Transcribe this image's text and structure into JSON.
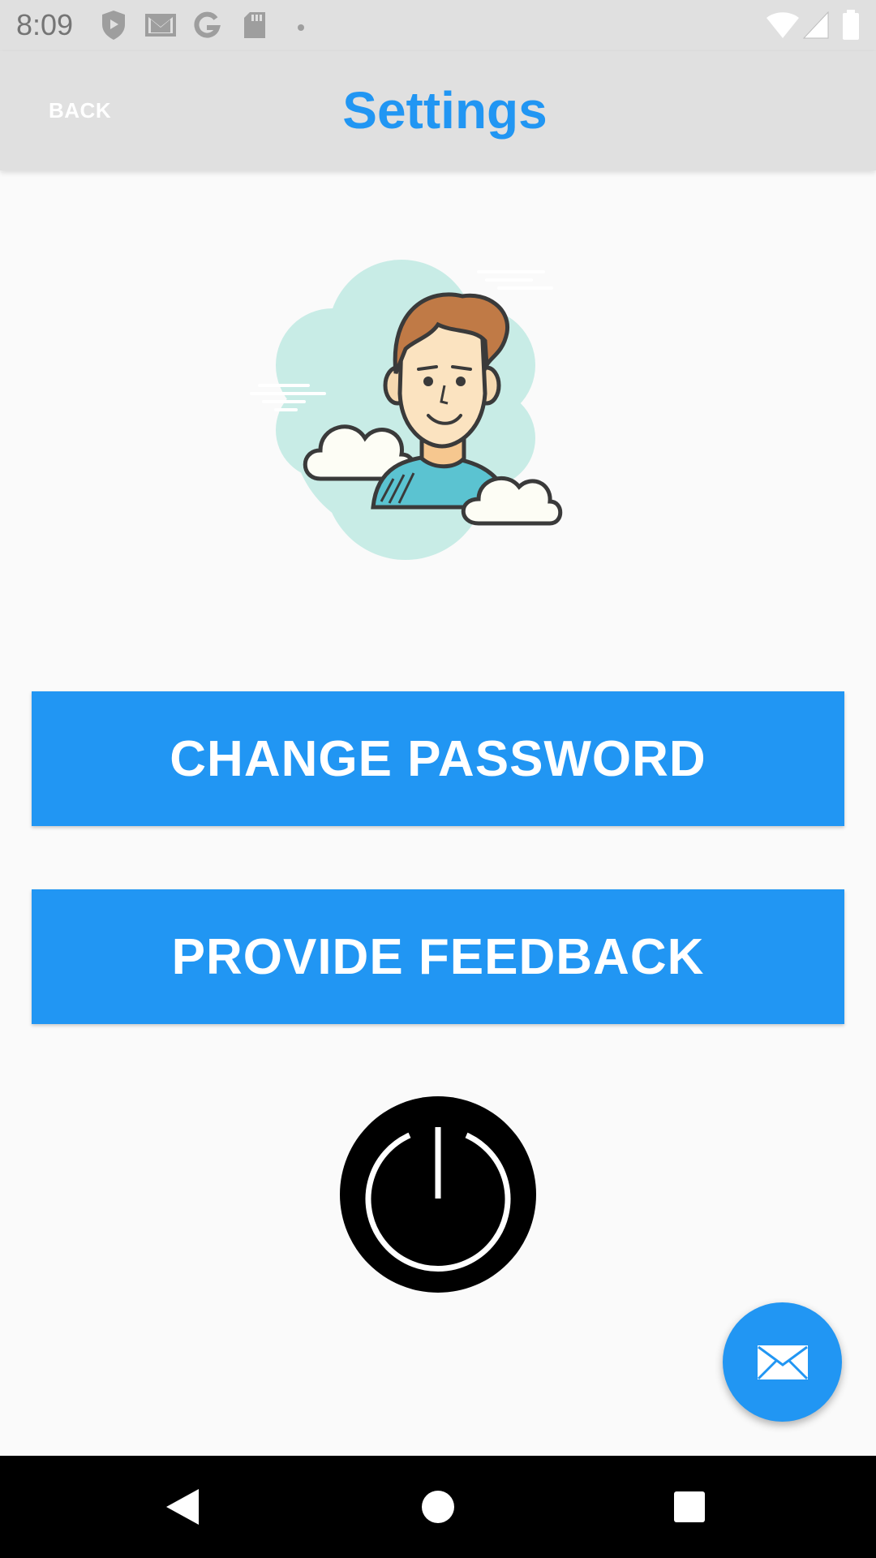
{
  "status_bar": {
    "time": "8:09",
    "left_icons": [
      "shield-icon",
      "gmail-icon",
      "google-icon",
      "sd-card-icon",
      "dot-icon"
    ],
    "right_icons": [
      "wifi-icon",
      "signal-icon",
      "battery-icon"
    ]
  },
  "app_bar": {
    "back_label": "BACK",
    "title": "Settings"
  },
  "avatar": {
    "icon": "user-avatar-illustration"
  },
  "actions": {
    "change_password_label": "CHANGE PASSWORD",
    "provide_feedback_label": "PROVIDE FEEDBACK"
  },
  "power": {
    "icon": "power-icon"
  },
  "fab": {
    "icon": "mail-icon"
  },
  "nav_bar": {
    "items": [
      "back-triangle-icon",
      "home-circle-icon",
      "recents-square-icon"
    ]
  },
  "colors": {
    "accent": "#2196f3",
    "app_bar_bg": "#e0e0e0",
    "background": "#fafafa"
  }
}
